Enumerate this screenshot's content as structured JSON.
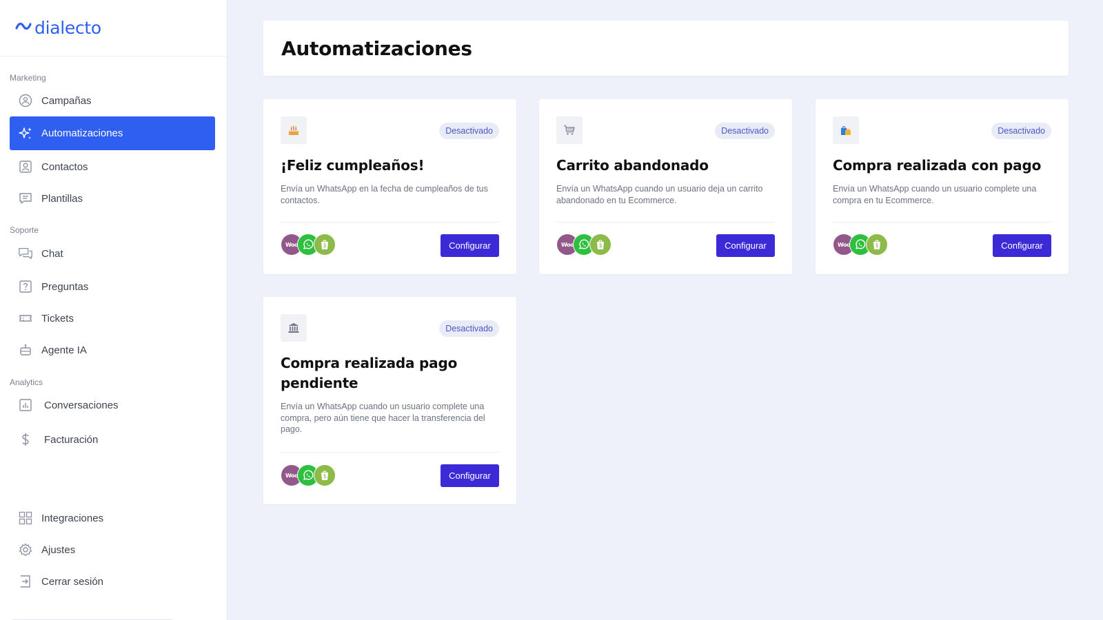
{
  "app": {
    "logo_text": "dialecto"
  },
  "sidebar": {
    "sections": {
      "marketing": "Marketing",
      "soporte": "Soporte",
      "analytics": "Analytics"
    },
    "items": [
      {
        "label": "Campañas",
        "icon": "campaign-icon"
      },
      {
        "label": "Automatizaciones",
        "icon": "sparkles-icon",
        "active": true
      },
      {
        "label": "Contactos",
        "icon": "contact-icon"
      },
      {
        "label": "Plantillas",
        "icon": "template-icon"
      },
      {
        "label": "Chat",
        "icon": "chat-icon"
      },
      {
        "label": "Preguntas",
        "icon": "question-icon"
      },
      {
        "label": "Tickets",
        "icon": "ticket-icon"
      },
      {
        "label": "Agente IA",
        "icon": "robot-icon"
      },
      {
        "label": "Conversaciones",
        "icon": "chart-icon"
      },
      {
        "label": "Facturación",
        "icon": "dollar-icon"
      },
      {
        "label": "Integraciones",
        "icon": "grid-icon"
      },
      {
        "label": "Ajustes",
        "icon": "gear-icon"
      },
      {
        "label": "Cerrar sesión",
        "icon": "logout-icon"
      }
    ]
  },
  "page": {
    "title": "Automatizaciones"
  },
  "colors": {
    "accent": "#2f5ff0",
    "button": "#3c2ad6",
    "badge_text": "#4a55c9"
  },
  "automations": [
    {
      "icon": "birthday-cake-icon",
      "status": "Desactivado",
      "title": "¡Feliz cumpleaños!",
      "description": "Envía un WhatsApp en la fecha de cumpleaños de tus contactos.",
      "button": "Configurar",
      "integrations": [
        "woocommerce-icon",
        "whatsapp-icon",
        "shopify-icon"
      ],
      "integration_woo_text": "Woo"
    },
    {
      "icon": "shopping-cart-icon",
      "status": "Desactivado",
      "title": "Carrito abandonado",
      "description": "Envía un WhatsApp cuando un usuario deja un carrito abandonado en tu Ecommerce.",
      "button": "Configurar",
      "integrations": [
        "woocommerce-icon",
        "whatsapp-icon",
        "shopify-icon"
      ],
      "integration_woo_text": "Woo"
    },
    {
      "icon": "shopping-bags-icon",
      "status": "Desactivado",
      "title": "Compra realizada con pago",
      "description": "Envía un WhatsApp cuando un usuario complete una compra en tu Ecommerce.",
      "button": "Configurar",
      "integrations": [
        "woocommerce-icon",
        "whatsapp-icon",
        "shopify-icon"
      ],
      "integration_woo_text": "Woo"
    },
    {
      "icon": "bank-icon",
      "status": "Desactivado",
      "title": "Compra realizada pago pendiente",
      "description": "Envía un WhatsApp cuando un usuario complete una compra, pero aún tiene que hacer la transferencia del pago.",
      "button": "Configurar",
      "integrations": [
        "woocommerce-icon",
        "whatsapp-icon",
        "shopify-icon"
      ],
      "integration_woo_text": "Woo"
    }
  ]
}
